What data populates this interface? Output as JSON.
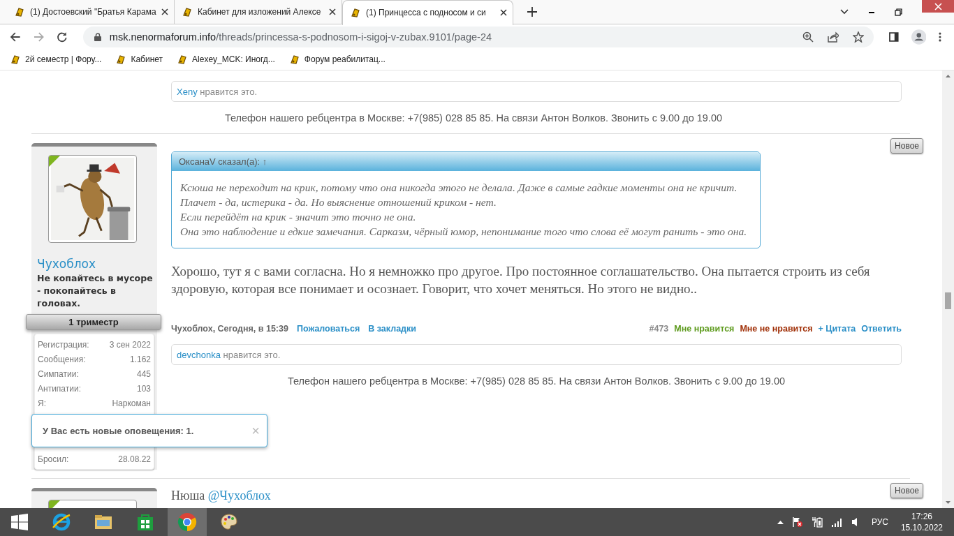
{
  "browser": {
    "tabs": [
      {
        "title": "(1) Достоевский \"Братья Карама",
        "selected": false
      },
      {
        "title": "Кабинет для изложений Алексе",
        "selected": false
      },
      {
        "title": "(1) Принцесса с подносом и си",
        "selected": true
      }
    ],
    "url": {
      "host": "msk.nenormaforum.info",
      "path": "/threads/princessa-s-podnosom-i-sigoj-v-zubax.9101/page-24"
    },
    "bookmarks": [
      "2й семестр | Фору...",
      "Кабинет",
      "Alexey_MCK: Иногд...",
      "Форум реабилитац..."
    ]
  },
  "page": {
    "top_like": {
      "user": "Xeny",
      "text": "нравится это."
    },
    "top_phone": "Телефон нашего ребцентра в Москве: +7(985) 028 85 85. На связи Антон Волков. Звонить с 9.00 до 19.00",
    "post": {
      "badge": "Новое",
      "user": {
        "online": true,
        "name": "Чухоблох",
        "title": "Не копайтесь в мусоре - покопайтесь в головах.",
        "rank": "1 триместр",
        "stats": [
          {
            "label": "Регистрация:",
            "value": "3 сен 2022"
          },
          {
            "label": "Сообщения:",
            "value": "1.162"
          },
          {
            "label": "Симпатии:",
            "value": "445"
          },
          {
            "label": "Антипатии:",
            "value": "103"
          },
          {
            "label": "Я:",
            "value": "Наркоман"
          },
          {
            "label": "Бросил:",
            "value": "28.08.22"
          }
        ]
      },
      "quote": {
        "header": "ОксанаV сказал(а): ↑",
        "paragraphs": [
          "Ксюша не переходит на крик, потому что она никогда этого не делала. Даже в самые гадкие моменты она не кричит. Плачет - да, истерика - да. Но выяснение отношений криком - нет.",
          "Если перейдёт на крик - значит это точно не она.",
          "Она это наблюдение и едкие замечания. Сарказм, чёрный юмор, непонимание того что слова её могут ранить - это она."
        ]
      },
      "text": "Хорошо, тут я с вами согласна. Но я немножко про другое. Про постоянное соглашательство. Она пытается строить из себя здоровую, которая все понимает и осознает. Говорит, что хочет меняться. Но этого не видно..",
      "byline": "Чухоблох, Сегодня, в 15:39",
      "links": [
        "Пожаловаться",
        "В закладки"
      ],
      "number": "#473",
      "actions": [
        {
          "label": "Мне нравится",
          "color": "#5e9b1e"
        },
        {
          "label": "Мне не нравится",
          "color": "#a03008"
        },
        {
          "label": "+ Цитата",
          "color": "#2a8fc7"
        },
        {
          "label": "Ответить",
          "color": "#2a8fc7"
        }
      ],
      "like": {
        "user": "devchonka",
        "text": "нравится это."
      },
      "phone": "Телефон нашего ребцентра в Москве: +7(985) 028 85 85. На связи Антон Волков. Звонить с 9.00 до 19.00"
    },
    "next_post": {
      "badge": "Новое",
      "online": true,
      "text": "Нюша ",
      "mention": "@Чухоблох"
    }
  },
  "notification": {
    "text": "У Вас есть новые оповещения: 1.",
    "close": "×"
  },
  "taskbar": {
    "apps": [
      {
        "kind": "ie",
        "selected": false
      },
      {
        "kind": "explorer",
        "selected": false
      },
      {
        "kind": "store",
        "selected": false
      },
      {
        "kind": "chrome",
        "selected": true
      },
      {
        "kind": "paint",
        "selected": false
      }
    ],
    "lang": "РУС",
    "time": "17:26",
    "date": "15.10.2022"
  }
}
